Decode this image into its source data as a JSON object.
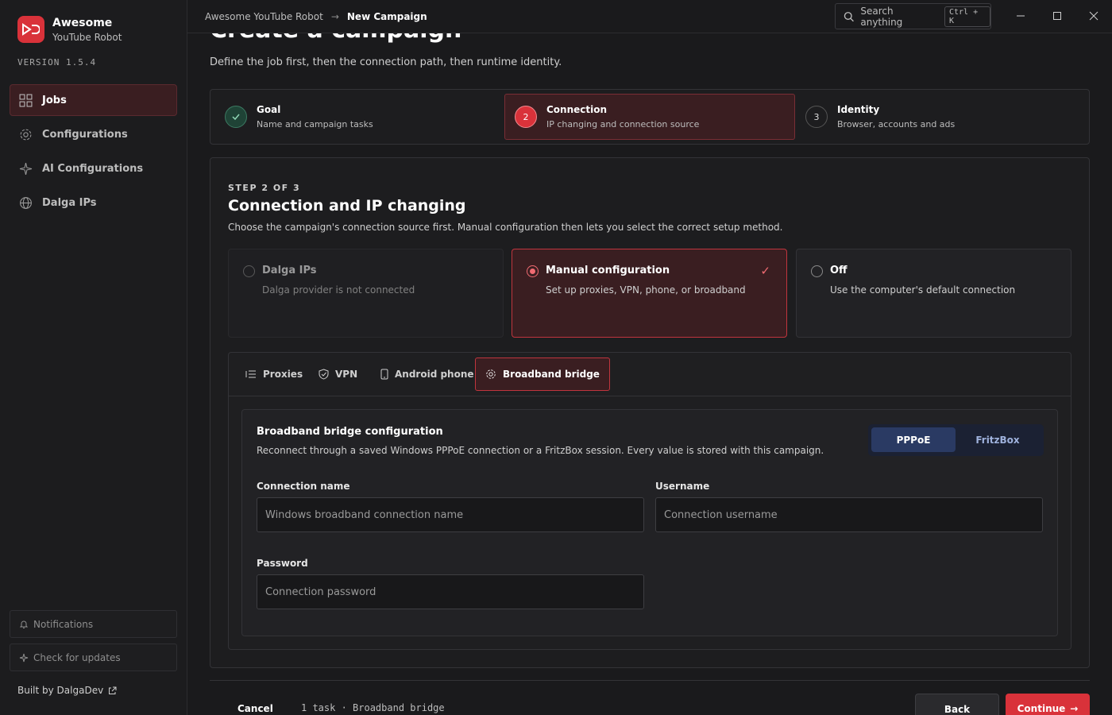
{
  "app": {
    "name": "Awesome",
    "subtitle": "YouTube Robot",
    "version": "VERSION 1.5.4"
  },
  "sidebar": {
    "items": [
      {
        "label": "Jobs",
        "icon": "grid-icon",
        "active": true
      },
      {
        "label": "Configurations",
        "icon": "gear-icon"
      },
      {
        "label": "AI Configurations",
        "icon": "sparkle-icon"
      },
      {
        "label": "Dalga IPs",
        "icon": "globe-icon"
      }
    ],
    "notifications": "Notifications",
    "check_updates": "Check for updates",
    "built_by": "Built by DalgaDev"
  },
  "topbar": {
    "breadcrumb": [
      "Awesome YouTube Robot",
      "New Campaign"
    ],
    "search_placeholder": "Search anything",
    "search_shortcut": "Ctrl + K"
  },
  "page": {
    "title": "Create a campaign",
    "subtitle": "Define the job first, then the connection path, then runtime identity."
  },
  "steps": [
    {
      "number": "1",
      "title": "Goal",
      "desc": "Name and campaign tasks",
      "state": "done"
    },
    {
      "number": "2",
      "title": "Connection",
      "desc": "IP changing and connection source",
      "state": "current"
    },
    {
      "number": "3",
      "title": "Identity",
      "desc": "Browser, accounts and ads",
      "state": "pending"
    }
  ],
  "panel": {
    "kicker": "STEP 2 OF 3",
    "title": "Connection and IP changing",
    "desc": "Choose the campaign's connection source first. Manual configuration then lets you select the correct setup method.",
    "options": [
      {
        "title": "Dalga IPs",
        "desc": "Dalga provider is not connected",
        "state": "disabled"
      },
      {
        "title": "Manual configuration",
        "desc": "Set up proxies, VPN, phone, or broadband",
        "state": "selected"
      },
      {
        "title": "Off",
        "desc": "Use the computer's default connection",
        "state": "off"
      }
    ],
    "tabs": [
      {
        "label": "Proxies",
        "icon": "list-icon"
      },
      {
        "label": "VPN",
        "icon": "shield-icon"
      },
      {
        "label": "Android phone",
        "icon": "phone-icon"
      },
      {
        "label": "Broadband bridge",
        "icon": "gear-icon",
        "active": true
      }
    ]
  },
  "broadband": {
    "title": "Broadband bridge configuration",
    "desc": "Reconnect through a saved Windows PPPoE connection or a FritzBox session. Every value is stored with this campaign.",
    "modes": [
      "PPPoE",
      "FritzBox"
    ],
    "selected_mode": "PPPoE",
    "fields": {
      "connection_name": {
        "label": "Connection name",
        "placeholder": "Windows broadband connection name",
        "value": ""
      },
      "username": {
        "label": "Username",
        "placeholder": "Connection username",
        "value": ""
      },
      "password": {
        "label": "Password",
        "placeholder": "Connection password",
        "value": ""
      }
    }
  },
  "footer": {
    "cancel": "Cancel",
    "info": "1 task · Broadband bridge",
    "back": "Back",
    "continue": "Continue"
  },
  "colors": {
    "accent": "#d9323a",
    "background": "#1a1a1c",
    "segment_on": "#2a3a63"
  }
}
